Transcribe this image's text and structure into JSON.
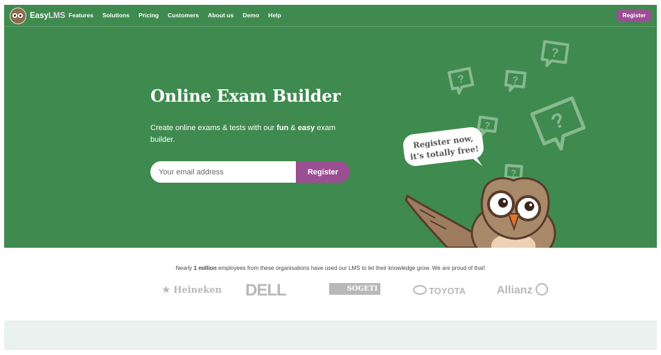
{
  "brand": {
    "name_part1": "Easy",
    "name_part2": "LMS"
  },
  "nav": {
    "items": [
      "Features",
      "Solutions",
      "Pricing",
      "Customers",
      "About us",
      "Demo",
      "Help"
    ],
    "register_label": "Register"
  },
  "hero": {
    "title": "Online Exam Builder",
    "desc_pre": "Create online exams & tests with our ",
    "desc_fun": "fun",
    "desc_mid": " & ",
    "desc_easy": "easy",
    "desc_post": " exam builder.",
    "email_placeholder": "Your email address",
    "register_button": "Register",
    "bubble_line1": "Register now,",
    "bubble_line2": "it's totally free!"
  },
  "social_proof": {
    "pre": "Nearly ",
    "bold": "1 million",
    "post": " employees from these organisations have used our LMS to let their knowledge grow. We are proud of that!",
    "logos": [
      "Heineken",
      "DELL",
      "SOGETI",
      "TOYOTA",
      "Allianz"
    ]
  },
  "colors": {
    "hero_green": "#3f8a4f",
    "accent_purple": "#9b4f93",
    "band": "#e9f2ee"
  }
}
